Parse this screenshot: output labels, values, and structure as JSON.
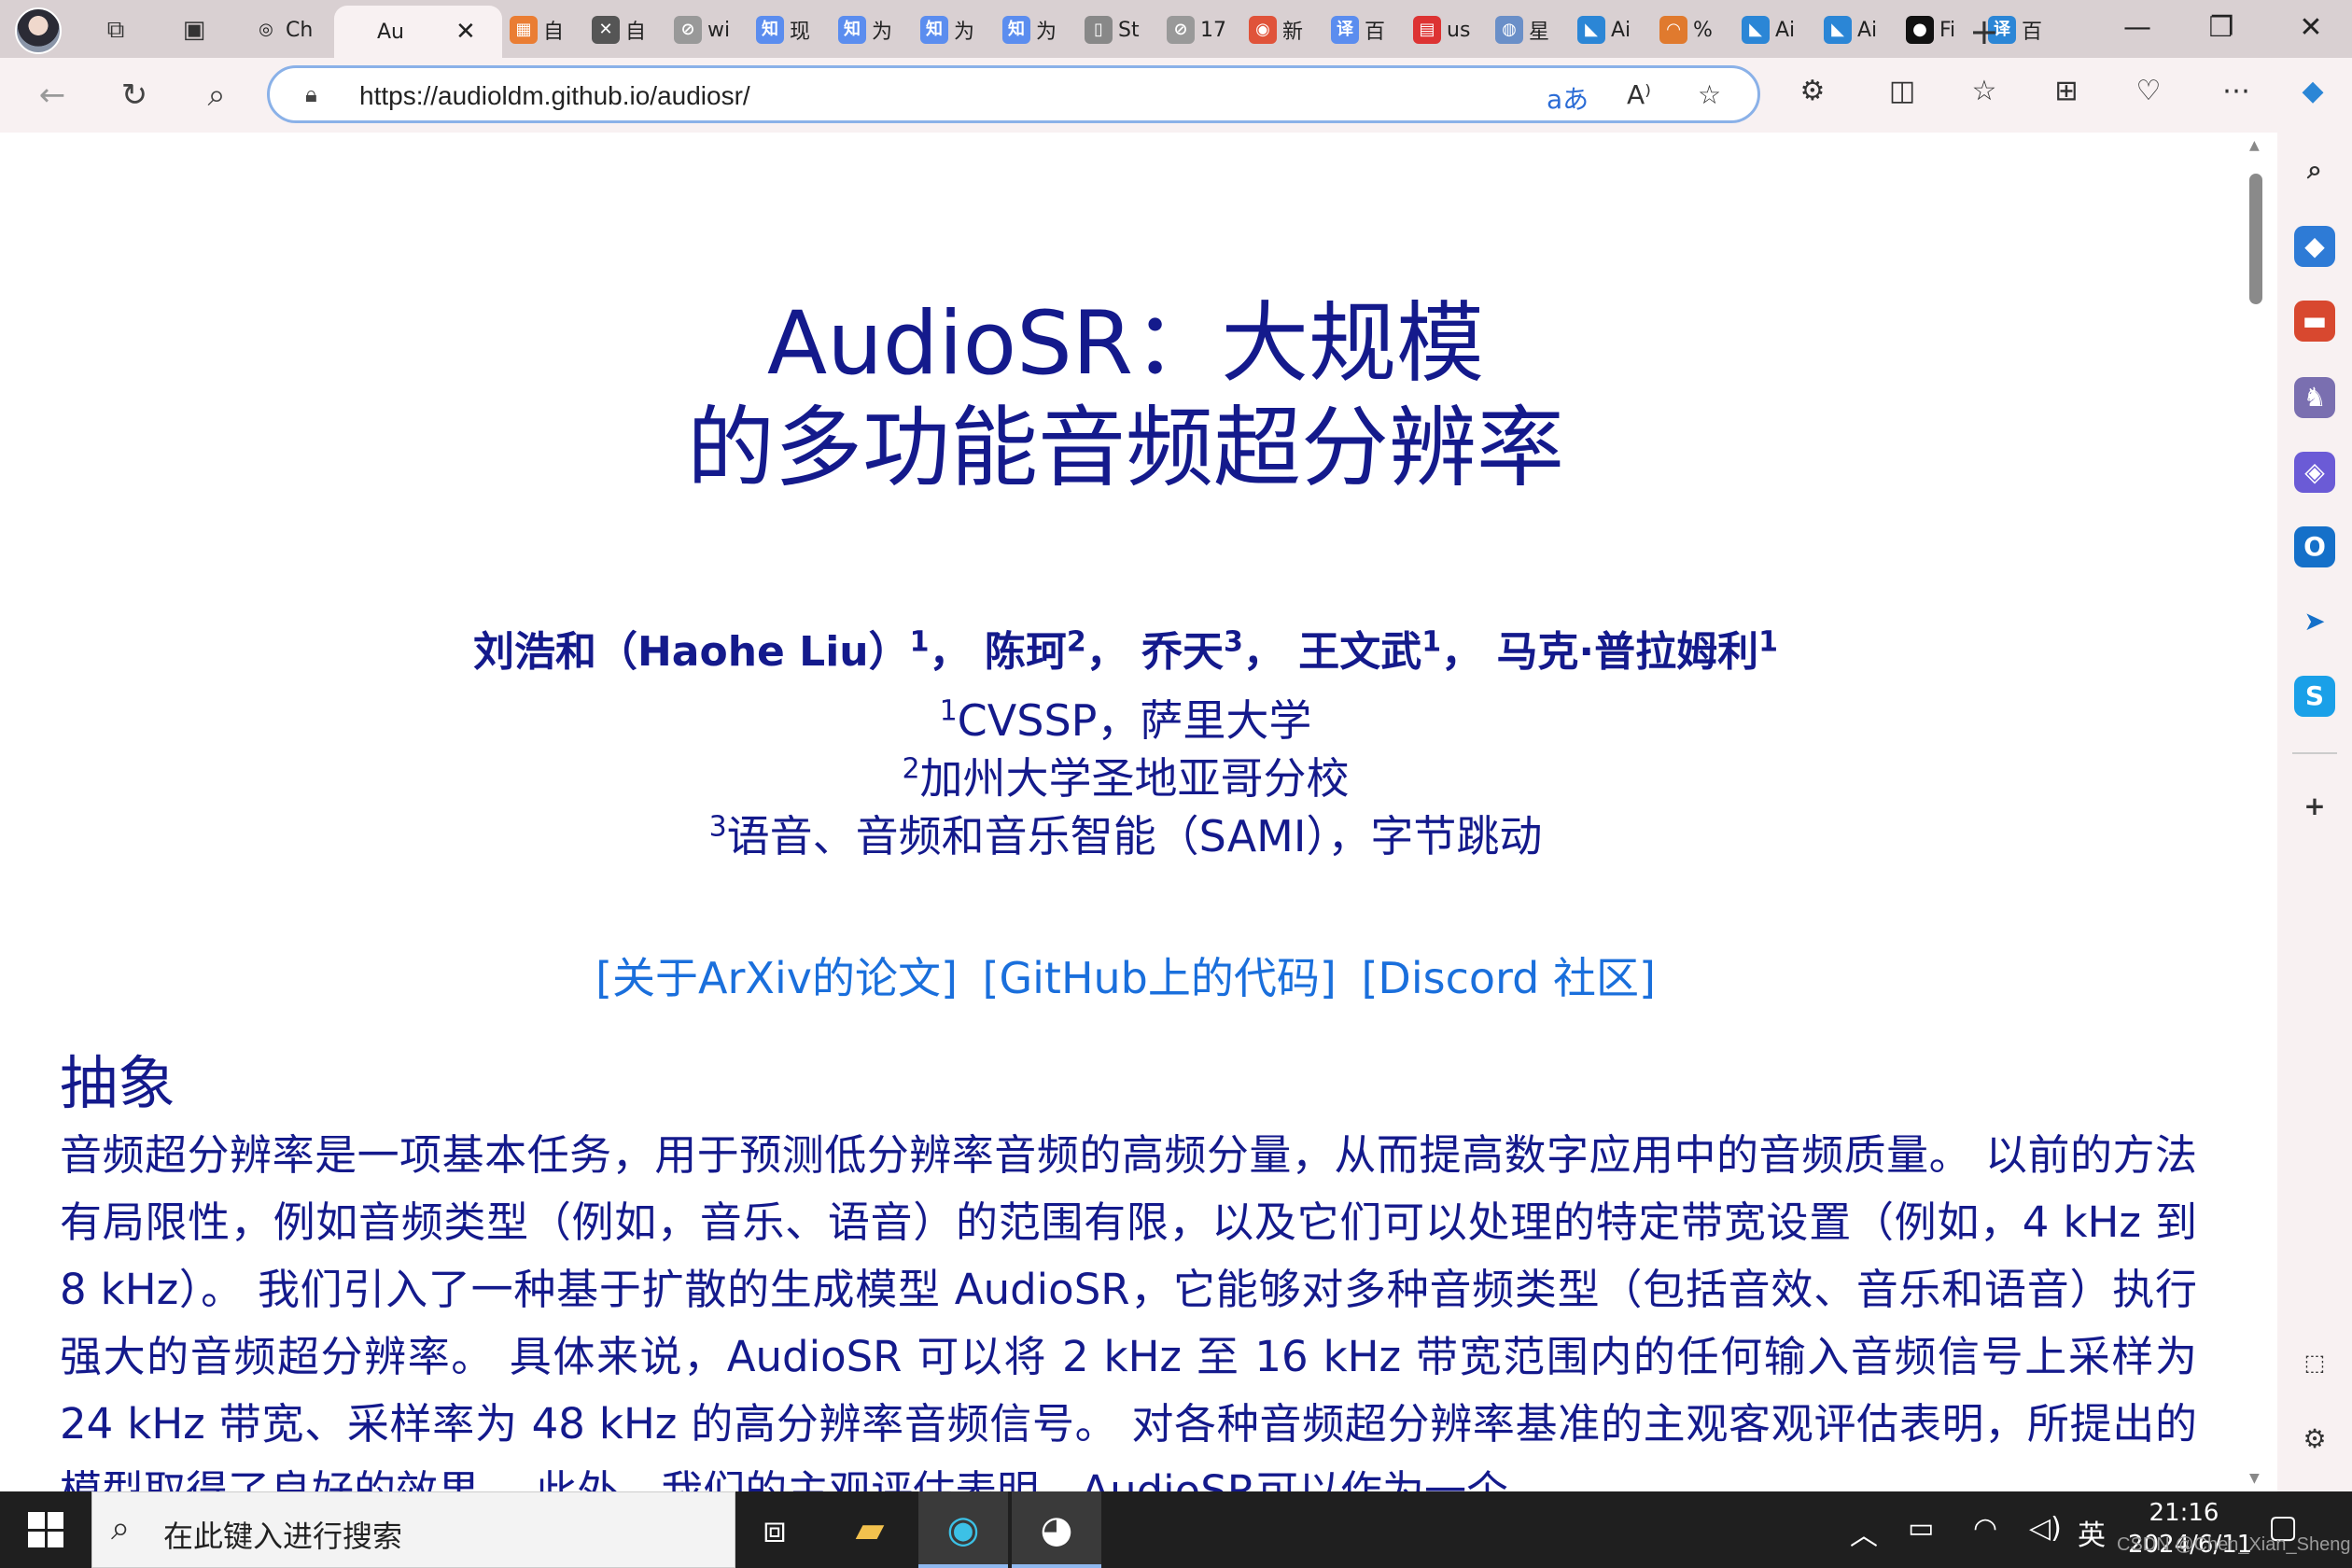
{
  "browser": {
    "url": "https://audioldm.github.io/audiosr/",
    "tabs": [
      {
        "label": "Ch",
        "icon": "chatgpt-icon",
        "color": "#ffffff",
        "glyph": "◎"
      },
      {
        "label": "Au",
        "icon": "page-icon",
        "color": "#ffffff",
        "glyph": "",
        "active": true
      },
      {
        "label": "自",
        "icon": "microsoft-icon",
        "color": "#ea7d33",
        "glyph": "▦"
      },
      {
        "label": "自",
        "icon": "x-icon",
        "color": "#555555",
        "glyph": "✕"
      },
      {
        "label": "wi",
        "icon": "blocked-icon",
        "color": "#999999",
        "glyph": "⊘"
      },
      {
        "label": "现",
        "icon": "zhihu-icon",
        "color": "#5b8def",
        "glyph": "知"
      },
      {
        "label": "为",
        "icon": "zhihu-icon",
        "color": "#5b8def",
        "glyph": "知"
      },
      {
        "label": "为",
        "icon": "zhihu-icon",
        "color": "#5b8def",
        "glyph": "知"
      },
      {
        "label": "为",
        "icon": "zhihu-icon",
        "color": "#5b8def",
        "glyph": "知"
      },
      {
        "label": "St",
        "icon": "document-icon",
        "color": "#888888",
        "glyph": "▯"
      },
      {
        "label": "17",
        "icon": "blocked-icon",
        "color": "#999999",
        "glyph": "⊘"
      },
      {
        "label": "新",
        "icon": "weibo-icon",
        "color": "#e0533a",
        "glyph": "◉"
      },
      {
        "label": "百",
        "icon": "translate-icon",
        "color": "#5b8def",
        "glyph": "译"
      },
      {
        "label": "us",
        "icon": "pdf-icon",
        "color": "#d33",
        "glyph": "▤"
      },
      {
        "label": "星",
        "icon": "app-icon",
        "color": "#6a8fc8",
        "glyph": "◍"
      },
      {
        "label": "Ai",
        "icon": "vscode-icon",
        "color": "#2b86d6",
        "glyph": "◣"
      },
      {
        "label": "%",
        "icon": "arc-icon",
        "color": "#e07a2e",
        "glyph": "◠"
      },
      {
        "label": "Ai",
        "icon": "vscode-icon",
        "color": "#2b86d6",
        "glyph": "◣"
      },
      {
        "label": "Ai",
        "icon": "vscode-icon",
        "color": "#2b86d6",
        "glyph": "◣"
      },
      {
        "label": "Fi",
        "icon": "github-icon",
        "color": "#111111",
        "glyph": "●"
      },
      {
        "label": "百",
        "icon": "translate-icon",
        "color": "#2b86d6",
        "glyph": "译"
      }
    ]
  },
  "page": {
    "title_line1": "AudioSR：大规模",
    "title_line2": "的多功能音频超分辨率",
    "authors": [
      {
        "name": "刘浩和（Haohe Liu）",
        "sup": "1"
      },
      {
        "name": "陈珂",
        "sup": "2"
      },
      {
        "name": "乔天",
        "sup": "3"
      },
      {
        "name": "王文武",
        "sup": "1"
      },
      {
        "name": "马克·普拉姆利",
        "sup": "1"
      }
    ],
    "affiliations": [
      {
        "sup": "1",
        "text": "CVSSP，萨里大学"
      },
      {
        "sup": "2",
        "text": "加州大学圣地亚哥分校"
      },
      {
        "sup": "3",
        "text": "语音、音频和音乐智能（SAMI），字节跳动"
      }
    ],
    "links": [
      "[关于ArXiv的论文]",
      "[GitHub上的代码]",
      "[Discord 社区]"
    ],
    "abstract_heading": "抽象",
    "abstract_text": "音频超分辨率是一项基本任务，用于预测低分辨率音频的高频分量，从而提高数字应用中的音频质量。 以前的方法有局限性，例如音频类型（例如，音乐、语音）的范围有限，以及它们可以处理的特定带宽设置（例如，4 kHz 到 8 kHz）。 我们引入了一种基于扩散的生成模型 AudioSR，它能够对多种音频类型（包括音效、音乐和语音）执行强大的音频超分辨率。 具体来说，AudioSR 可以将 2 kHz 至 16 kHz 带宽范围内的任何输入音频信号上采样为 24 kHz 带宽、采样率为 48 kHz 的高分辨率音频信号。 对各种音频超分辨率基准的主观客观评估表明，所提出的模型取得了良好的效果。 此外，我们的主观评估表明，AudioSR可以作为一个"
  },
  "taskbar": {
    "search_placeholder": "在此键入进行搜索",
    "ime": "英",
    "time": "21:16",
    "date": "2024/6/11",
    "watermark": "CSDN @Chen_Xian_Sheng"
  },
  "colors": {
    "title": "#141a8c",
    "link": "#1a6fdc",
    "accent": "#8ab1e8"
  }
}
